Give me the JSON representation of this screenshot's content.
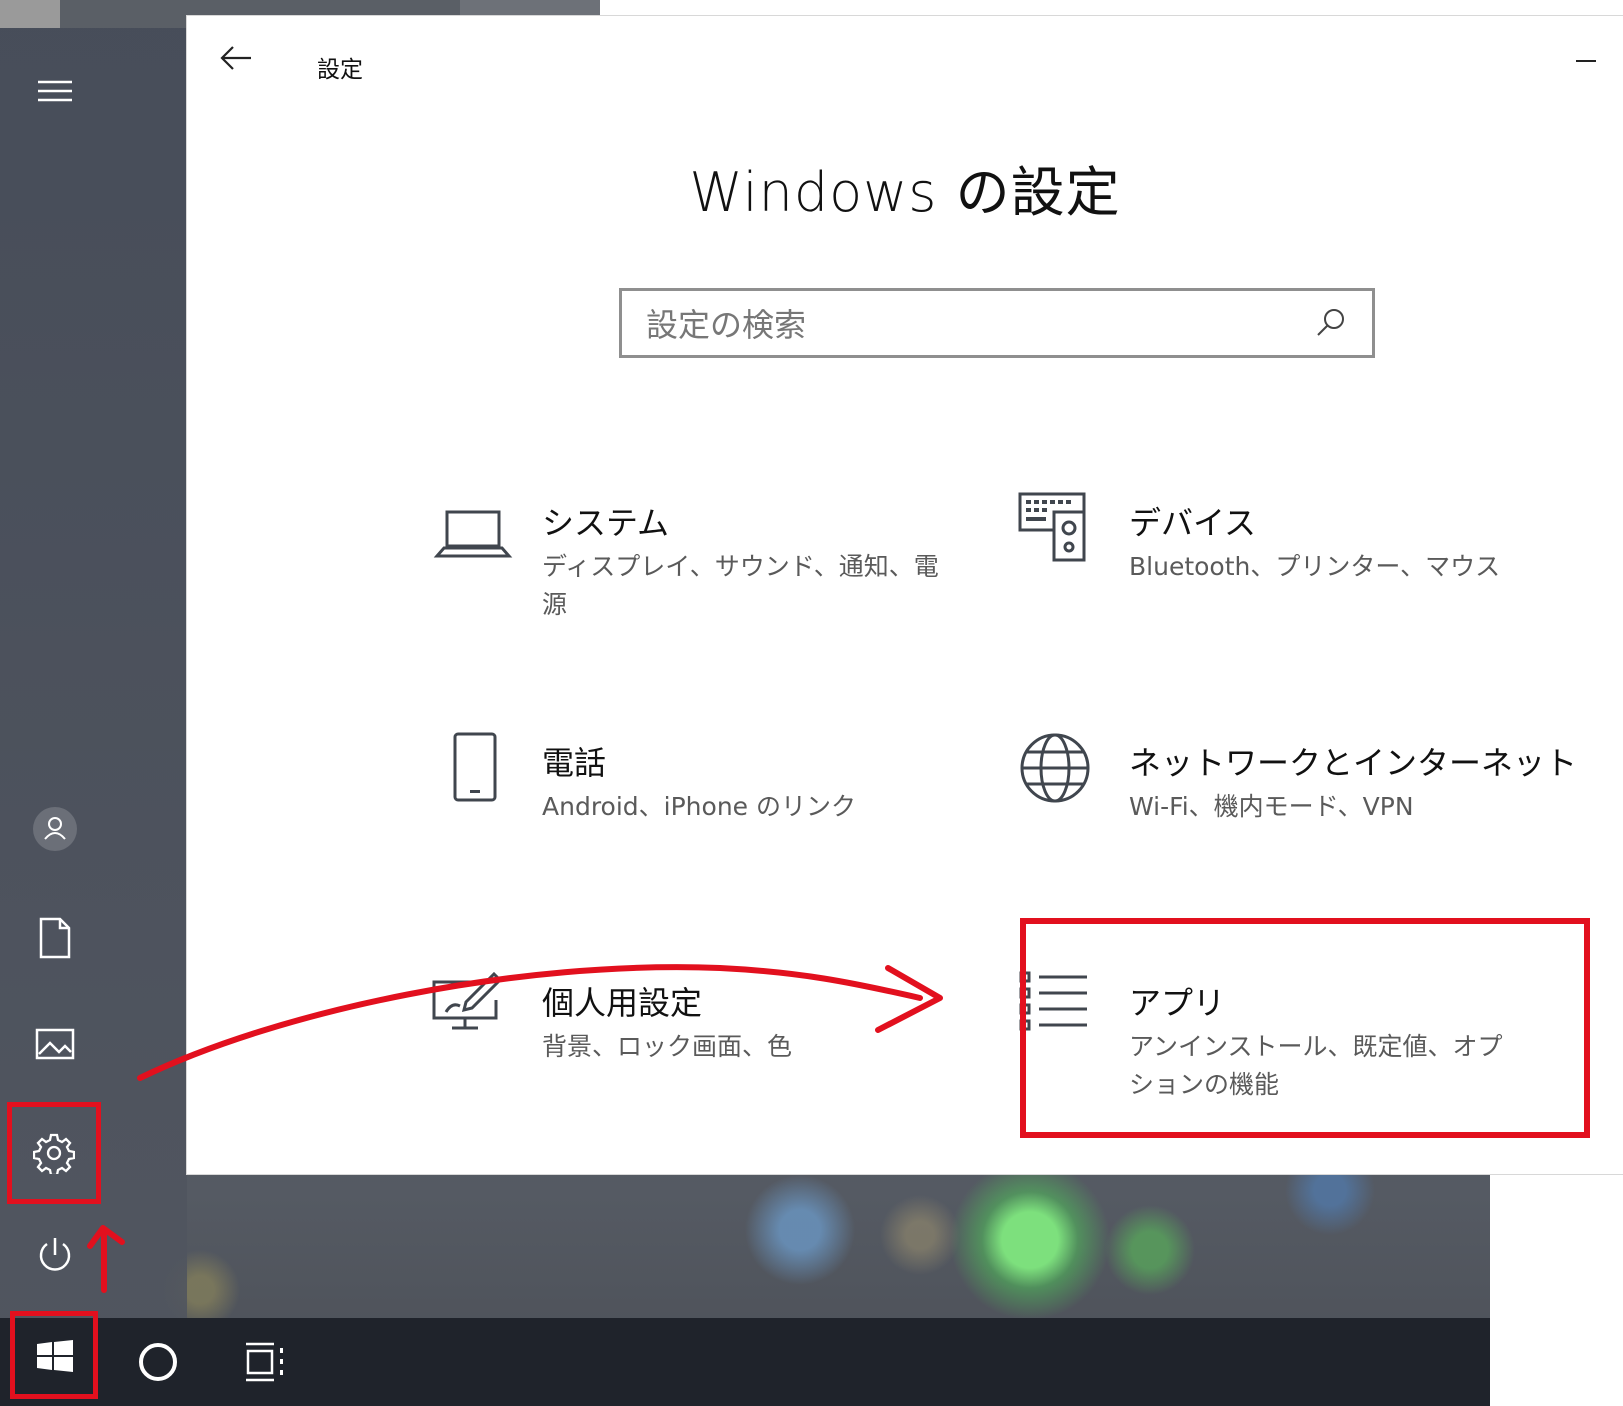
{
  "window": {
    "title": "設定",
    "heading": "Windows の設定"
  },
  "search": {
    "placeholder": "設定の検索"
  },
  "tiles": [
    {
      "name": "システム",
      "desc": "ディスプレイ、サウンド、通知、電源",
      "icon": "laptop-icon"
    },
    {
      "name": "デバイス",
      "desc": "Bluetooth、プリンター、マウス",
      "icon": "devices-icon"
    },
    {
      "name": "電話",
      "desc": "Android、iPhone のリンク",
      "icon": "phone-icon"
    },
    {
      "name": "ネットワークとインターネット",
      "desc": "Wi-Fi、機内モード、VPN",
      "icon": "globe-icon"
    },
    {
      "name": "個人用設定",
      "desc": "背景、ロック画面、色",
      "icon": "personalization-icon"
    },
    {
      "name": "アプリ",
      "desc": "アンインストール、既定値、オプションの機能",
      "icon": "apps-list-icon"
    }
  ],
  "start_rail": {
    "items": [
      "hamburger-icon",
      "user-icon",
      "document-icon",
      "pictures-icon",
      "settings-gear-icon",
      "power-icon"
    ]
  },
  "taskbar": {
    "items": [
      "windows-start-icon",
      "cortana-icon",
      "task-view-icon"
    ]
  },
  "colors": {
    "highlight": "#e2101e",
    "window_bg": "#ffffff",
    "taskbar_bg": "#1f232b"
  }
}
